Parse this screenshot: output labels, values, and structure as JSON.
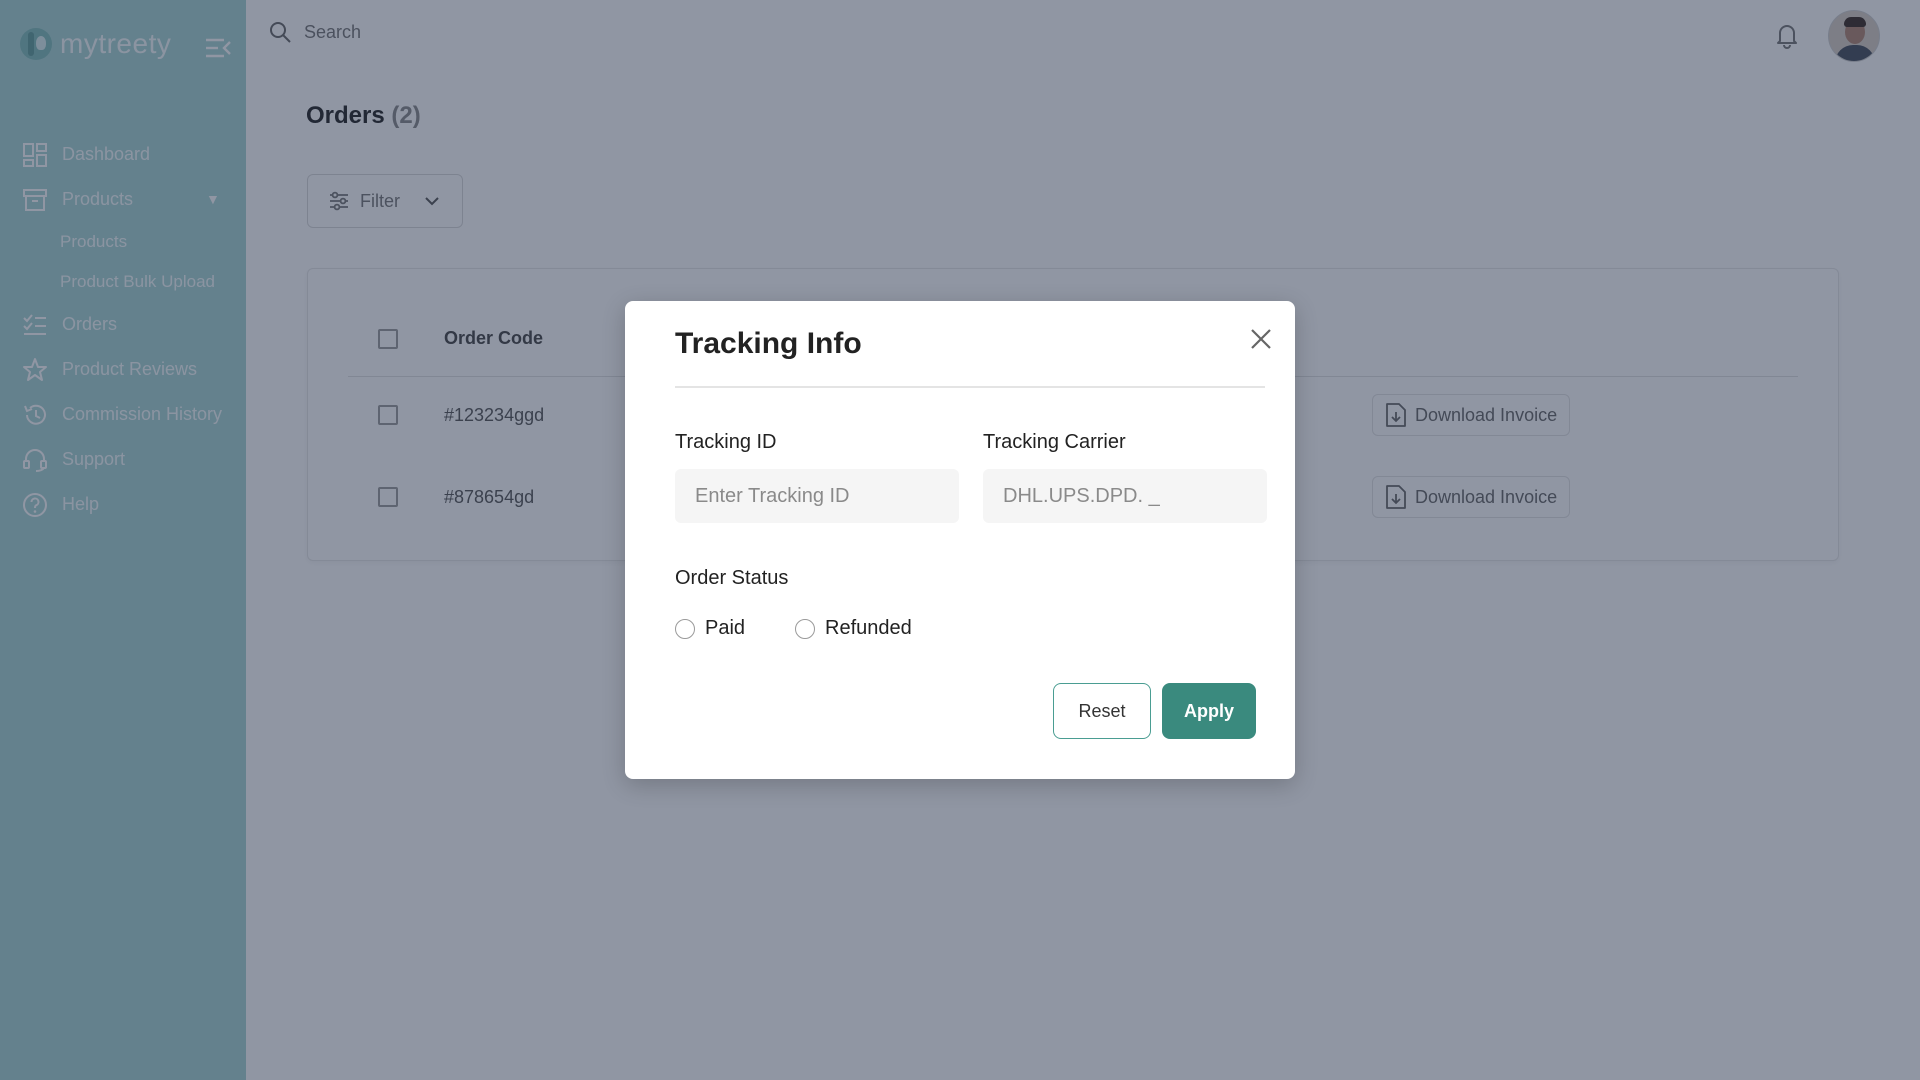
{
  "brand": {
    "name": "mytreety"
  },
  "sidebar": {
    "items": [
      {
        "label": "Dashboard",
        "icon": "dashboard-icon"
      },
      {
        "label": "Products",
        "icon": "archive-box-icon",
        "expanded": true,
        "children": [
          {
            "label": "Products"
          },
          {
            "label": "Product Bulk Upload"
          }
        ]
      },
      {
        "label": "Orders",
        "icon": "checklist-icon"
      },
      {
        "label": "Product Reviews",
        "icon": "star-icon"
      },
      {
        "label": "Commission History",
        "icon": "history-icon"
      },
      {
        "label": "Support",
        "icon": "headset-icon"
      },
      {
        "label": "Help",
        "icon": "help-circle-icon"
      }
    ]
  },
  "header": {
    "search_placeholder": "Search"
  },
  "page": {
    "title": "Orders",
    "count": "(2)",
    "filter_label": "Filter"
  },
  "table": {
    "header": {
      "order_code": "Order Code"
    },
    "rows": [
      {
        "order_code": "#123234ggd",
        "action": "Download Invoice"
      },
      {
        "order_code": "#878654gd",
        "action": "Download Invoice"
      }
    ]
  },
  "modal": {
    "title": "Tracking Info",
    "tracking_id": {
      "label": "Tracking ID",
      "placeholder": "Enter Tracking ID",
      "value": ""
    },
    "tracking_carrier": {
      "label": "Tracking Carrier",
      "placeholder": "DHL.UPS.DPD. _",
      "value": ""
    },
    "order_status": {
      "label": "Order Status",
      "options": [
        {
          "label": "Paid",
          "selected": false
        },
        {
          "label": "Refunded",
          "selected": false
        }
      ]
    },
    "reset_label": "Reset",
    "apply_label": "Apply"
  },
  "colors": {
    "sidebar_bg": "#a6d4d2",
    "accent": "#3a8a7e",
    "overlay": "rgba(34,46,72,0.5)"
  }
}
